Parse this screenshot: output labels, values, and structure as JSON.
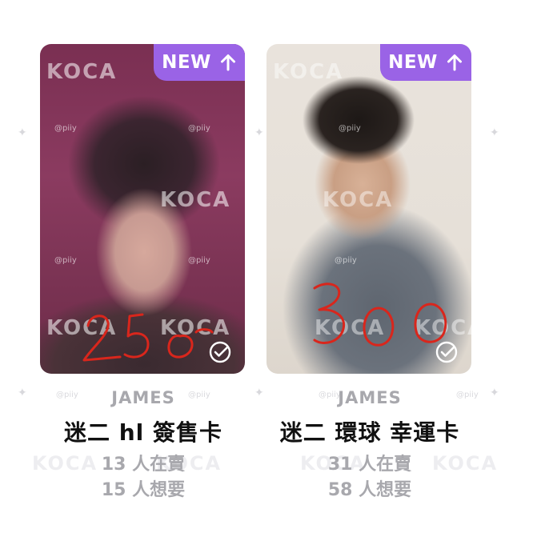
{
  "cards": [
    {
      "badge": "NEW",
      "badge_color": "#9a63e6",
      "handwritten_price": "250",
      "artist": "JAMES",
      "title": "迷二 hl 簽售卡",
      "sellers": "13 人在賣",
      "wanted": "15 人想要"
    },
    {
      "badge": "NEW",
      "badge_color": "#9a63e6",
      "handwritten_price": "300",
      "artist": "JAMES",
      "title": "迷二 環球 幸運卡",
      "sellers": "31 人在賣",
      "wanted": "58 人想要"
    }
  ],
  "watermark": {
    "brand": "KOCA",
    "handle": "@piiy"
  },
  "icons": {
    "badge_icon": "arrow-up-icon",
    "card_icon": "check-circle-icon"
  },
  "colors": {
    "handwriting": "#d9261c",
    "muted_text": "#a8a8ad"
  }
}
